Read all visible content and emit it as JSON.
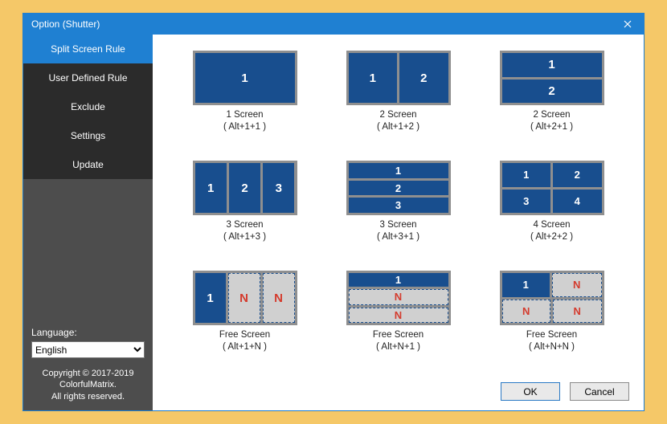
{
  "window_title": "Option (Shutter)",
  "sidebar": {
    "items": [
      {
        "label": "Split Screen Rule",
        "active": true
      },
      {
        "label": "User Defined Rule",
        "active": false
      },
      {
        "label": "Exclude",
        "active": false
      },
      {
        "label": "Settings",
        "active": false
      },
      {
        "label": "Update",
        "active": false
      }
    ]
  },
  "language": {
    "label": "Language:",
    "value": "English"
  },
  "copyright": {
    "line1": "Copyright © 2017-2019",
    "line2": "ColorfulMatrix.",
    "line3": "All rights reserved."
  },
  "rules": [
    {
      "name": "1 Screen",
      "shortcut": "( Alt+1+1 )"
    },
    {
      "name": "2 Screen",
      "shortcut": "( Alt+1+2 )"
    },
    {
      "name": "2 Screen",
      "shortcut": "( Alt+2+1 )"
    },
    {
      "name": "3 Screen",
      "shortcut": "( Alt+1+3 )"
    },
    {
      "name": "3 Screen",
      "shortcut": "( Alt+3+1 )"
    },
    {
      "name": "4 Screen",
      "shortcut": "( Alt+2+2 )"
    },
    {
      "name": "Free Screen",
      "shortcut": "( Alt+1+N )"
    },
    {
      "name": "Free Screen",
      "shortcut": "( Alt+N+1 )"
    },
    {
      "name": "Free Screen",
      "shortcut": "( Alt+N+N )"
    }
  ],
  "glyph": {
    "n1": "1",
    "n2": "2",
    "n3": "3",
    "n4": "4",
    "N": "N"
  },
  "buttons": {
    "ok": "OK",
    "cancel": "Cancel"
  }
}
